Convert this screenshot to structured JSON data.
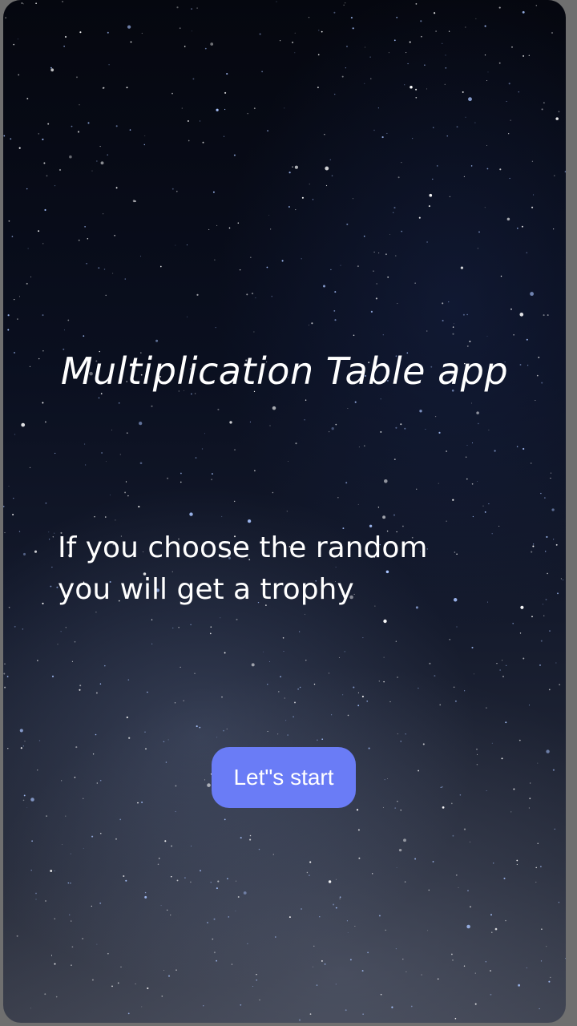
{
  "app": {
    "title": "Multiplication Table app",
    "message_line_1": "If you choose the random",
    "message_line_2": "you will get a trophy",
    "start_button_label": "Let\"s start"
  },
  "colors": {
    "background_top": "#05070f",
    "background_bottom": "#3a3e4b",
    "button": "#6a7cf6",
    "text": "#ffffff"
  },
  "background": {
    "image": "starry-night-sky"
  }
}
